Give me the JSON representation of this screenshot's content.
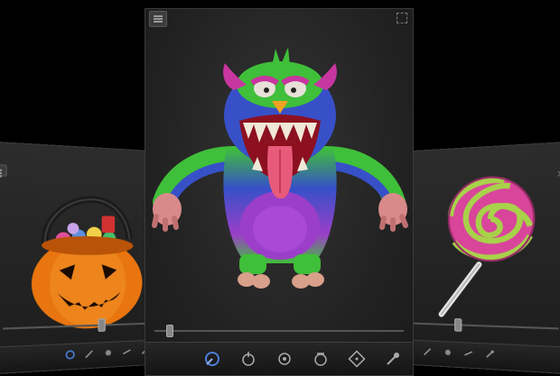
{
  "scene": {
    "background_color": "#000000",
    "panel_color": "#242424"
  },
  "left_panel": {
    "subject": "pumpkin-candy-bucket",
    "close_icon": "close-icon",
    "tools": [
      "brush-icon",
      "pencil-icon",
      "smooth-icon",
      "flatten-icon",
      "mask-icon"
    ]
  },
  "center_panel": {
    "subject": "furry-monster-sculpt",
    "menu_icon": "menu-icon",
    "fullscreen_icon": "fullscreen-icon",
    "slider_position": 0.05,
    "tools": [
      "sculpt-brush-icon",
      "grab-icon",
      "inflate-icon",
      "pinch-icon",
      "texture-icon",
      "dropper-icon"
    ],
    "active_tool": "sculpt-brush-icon",
    "colors": {
      "fur_green": "#3fbf3a",
      "fur_blue": "#3750c8",
      "fur_purple": "#9b3fc8",
      "skin_pink": "#d88a8a",
      "horn_magenta": "#c8369f",
      "mouth_red": "#8c1020"
    }
  },
  "right_panel": {
    "subject": "swirl-lollipop",
    "close_icon": "close-icon",
    "tools": [
      "brush-icon",
      "pencil-icon",
      "smooth-icon",
      "flatten-icon",
      "mask-icon"
    ]
  }
}
